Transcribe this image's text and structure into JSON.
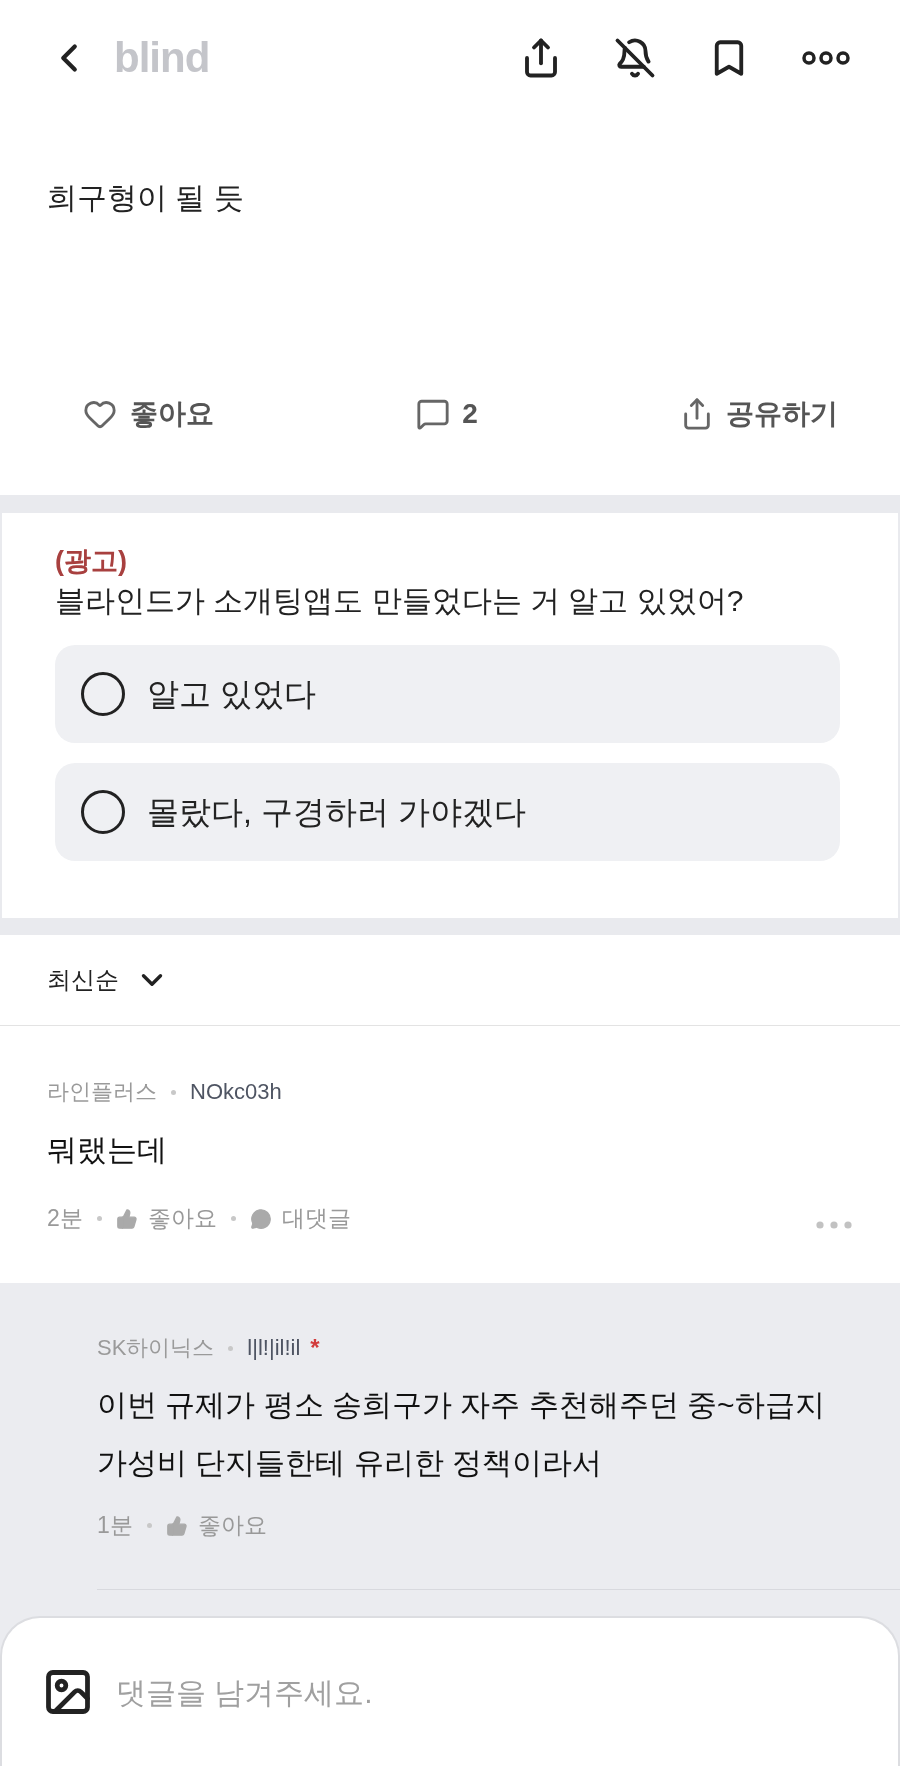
{
  "header": {
    "logo": "blind"
  },
  "post": {
    "body": "희구형이 될 듯",
    "actions": [
      {
        "kind": "like",
        "label": "좋아요"
      },
      {
        "kind": "comment",
        "label": "2"
      },
      {
        "kind": "share",
        "label": "공유하기"
      }
    ]
  },
  "ad_poll": {
    "tag": "(광고)",
    "question": "블라인드가 소개팅앱도 만들었다는 거 알고 있었어?",
    "options": [
      {
        "label": "알고 있었다",
        "selected": false
      },
      {
        "label": "몰랐다, 구경하러 가야겠다",
        "selected": false
      }
    ]
  },
  "sort": {
    "label": "최신순"
  },
  "comments": [
    {
      "company": "라인플러스",
      "nickname": "NOkc03h",
      "body": "뭐랬는데",
      "time": "2분",
      "like_label": "좋아요",
      "reply_label": "대댓글",
      "children": [
        {
          "company": "SK하이닉스",
          "nickname": "l|l!|il!il",
          "mark": "*",
          "body": "이번 규제가 평소 송희구가 자주 추천해주던 중~하급지 가성비 단지들한테 유리한 정책이라서",
          "time": "1분",
          "like_label": "좋아요"
        }
      ]
    }
  ],
  "composer": {
    "placeholder": "댓글을 남겨주세요."
  }
}
